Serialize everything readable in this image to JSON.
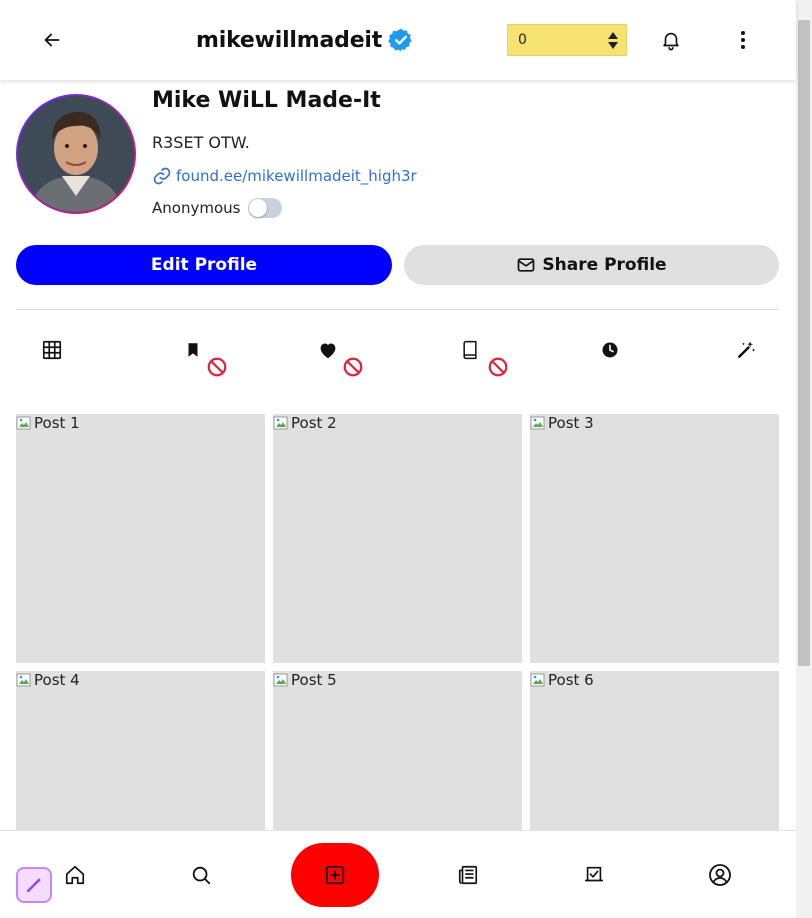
{
  "header": {
    "username": "mikewillmadeit",
    "stepper_value": "0",
    "icons": {
      "back": "arrow-left-icon",
      "verified": "verified-badge-icon",
      "notifications": "bell-icon",
      "more": "more-vertical-icon"
    }
  },
  "profile": {
    "display_name": "Mike WiLL Made-It",
    "bio": "R3SET OTW.",
    "link": "found.ee/mikewillmadeit_high3r",
    "anonymous_label": "Anonymous",
    "anonymous_enabled": false
  },
  "actions": {
    "edit_label": "Edit Profile",
    "share_label": "Share Profile"
  },
  "tabs": [
    {
      "name": "grid-icon",
      "blocked": false
    },
    {
      "name": "bookmark-icon",
      "blocked": true
    },
    {
      "name": "heart-icon",
      "blocked": true
    },
    {
      "name": "book-icon",
      "blocked": true
    },
    {
      "name": "clock-icon",
      "blocked": false
    },
    {
      "name": "magic-wand-icon",
      "blocked": false
    }
  ],
  "posts": [
    {
      "alt": "Post 1"
    },
    {
      "alt": "Post 2"
    },
    {
      "alt": "Post 3"
    },
    {
      "alt": "Post 4"
    },
    {
      "alt": "Post 5"
    },
    {
      "alt": "Post 6"
    }
  ],
  "bottom_nav": [
    "magic-wand-icon",
    "home-icon",
    "search-icon",
    "create-icon",
    "news-icon",
    "task-icon",
    "profile-icon"
  ],
  "colors": {
    "primary_button": "#0000ff",
    "create_button": "#ff0000",
    "stepper_bg": "#f5e270",
    "link": "#2f6fd6",
    "avatar_ring_start": "#5b2bff",
    "avatar_ring_end": "#e0185c",
    "block_icon": "#e5213a"
  }
}
